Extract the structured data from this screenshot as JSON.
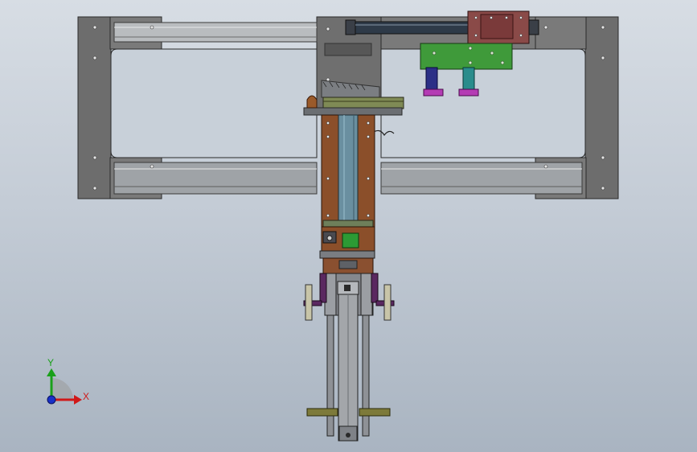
{
  "viewport": {
    "background_top": "#d7dde4",
    "background_bottom": "#a9b4c1"
  },
  "triad": {
    "y_label": "Y",
    "x_label": "X",
    "y_color": "#1aa01a",
    "x_color": "#d01818",
    "z_color": "#1830c8"
  },
  "colors": {
    "frame_plate": "#6d6d6d",
    "rail_light": "#b9bcbf",
    "column_brown": "#8b4f2a",
    "cylinder_body": "#2e3a48",
    "cylinder_mount": "#8a4a48",
    "bracket_green": "#3f9a3a",
    "ram_blue": "#2b2f86",
    "ram_teal": "#2a8c8c",
    "foot_magenta": "#b43cb4",
    "tray_olive": "#7f8a55",
    "shaft_blue": "#6a8fa0",
    "purple_mount": "#5a2860",
    "rod_gray": "#8e9196",
    "clamp_olive": "#7d7a3a"
  }
}
